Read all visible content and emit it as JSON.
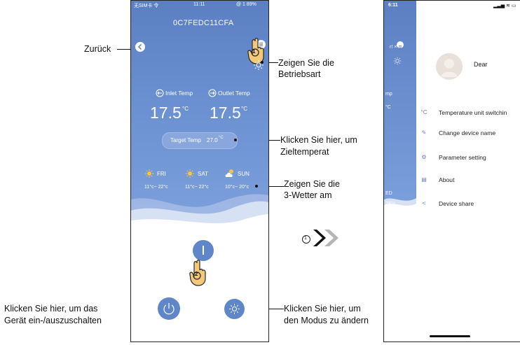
{
  "callouts": {
    "back": "Zurück",
    "mode_view_1": "Zeigen Sie die",
    "mode_view_2": "Betriebsart",
    "target_1": "Klicken Sie hier, um",
    "target_2": "Zieltemperat",
    "weather_1": "Zeigen Sie die",
    "weather_2": "3-Wetter am",
    "power_1": "Klicken Sie hier, um das",
    "power_2": "Gerät ein-/auszuschalten",
    "mode_change_1": "Klicken Sie hier, um",
    "mode_change_2": "den Modus zu ändern"
  },
  "phone1": {
    "status_left": "无SIM卡 令",
    "status_time": "11:11",
    "status_right": "@ 1 89%",
    "device_id": "0C7FEDC11CFA",
    "inlet_label": "Inlet Temp",
    "outlet_label": "Outlet Temp",
    "inlet_value": "17.5",
    "outlet_value": "17.5",
    "unit": "°C",
    "target_label": "Target Temp",
    "target_value": "27.0",
    "target_unit": "°C",
    "weather": [
      {
        "day": "FRI",
        "range": "11°c~ 22°c"
      },
      {
        "day": "SAT",
        "range": "11°c~ 22°c"
      },
      {
        "day": "SUN",
        "range": "10°c~ 20°c"
      }
    ],
    "step_marker_1": "1",
    "step_marker_2": "2"
  },
  "arrows": {
    "step": "1"
  },
  "phone2": {
    "status_time": "6:11",
    "strip_temp_label": "mp",
    "strip_temp_unit": "°C",
    "strip_ed": "ED",
    "strip_temp2": "28°c",
    "strip_x": "r! ×",
    "user_name": "Dear",
    "menu": [
      {
        "icon": "°C",
        "label": "Temperature unit switchin"
      },
      {
        "icon": "✎",
        "label": "Change device name"
      },
      {
        "icon": "⚙",
        "label": "Parameter setting"
      },
      {
        "icon": "▤",
        "label": "About"
      },
      {
        "icon": "<",
        "label": "Device share"
      }
    ]
  },
  "colors": {
    "accent": "#5b7fc2",
    "button": "#5f86c8",
    "menu_icon": "#6b7db5"
  }
}
